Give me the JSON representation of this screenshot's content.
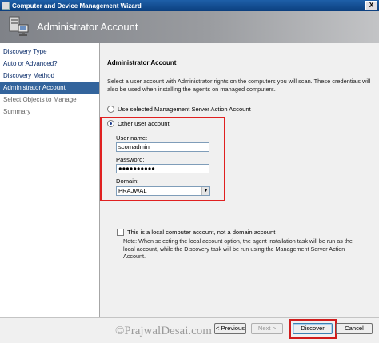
{
  "window": {
    "title": "Computer and Device Management Wizard",
    "close_glyph": "X"
  },
  "banner": {
    "title": "Administrator Account",
    "icon": "wizard-computer-icon"
  },
  "sidebar": {
    "items": [
      {
        "label": "Discovery Type",
        "state": "normal"
      },
      {
        "label": "Auto or Advanced?",
        "state": "normal"
      },
      {
        "label": "Discovery Method",
        "state": "normal"
      },
      {
        "label": "Administrator Account",
        "state": "active"
      },
      {
        "label": "Select Objects to Manage",
        "state": "disabled"
      },
      {
        "label": "Summary",
        "state": "disabled"
      }
    ]
  },
  "main": {
    "section_title": "Administrator Account",
    "description": "Select a user account with Administrator rights on the computers you will scan. These credentials will also be used when installing the agents on managed computers.",
    "radio_management": {
      "label": "Use selected Management Server Action Account",
      "checked": false
    },
    "radio_other": {
      "label": "Other user account",
      "checked": true
    },
    "username": {
      "label": "User name:",
      "value": "scomadmin"
    },
    "password": {
      "label": "Password:",
      "value": "●●●●●●●●●●"
    },
    "domain": {
      "label": "Domain:",
      "value": "PRAJWAL",
      "arrow": "▼"
    },
    "local_account": {
      "label": "This is a local computer account, not a domain account",
      "checked": false
    },
    "note": "Note:  When selecting the local account option, the agent installation task will be run as the local account, while the Discovery task will be run using the Management Server Action Account."
  },
  "footer": {
    "watermark": "©PrajwalDesai.com",
    "previous_label": "< Previous",
    "next_label": "Next >",
    "discover_label": "Discover",
    "cancel_label": "Cancel"
  },
  "colors": {
    "titlebar": "#0b3f7e",
    "nav_active": "#33649c",
    "highlight": "#e02020"
  }
}
